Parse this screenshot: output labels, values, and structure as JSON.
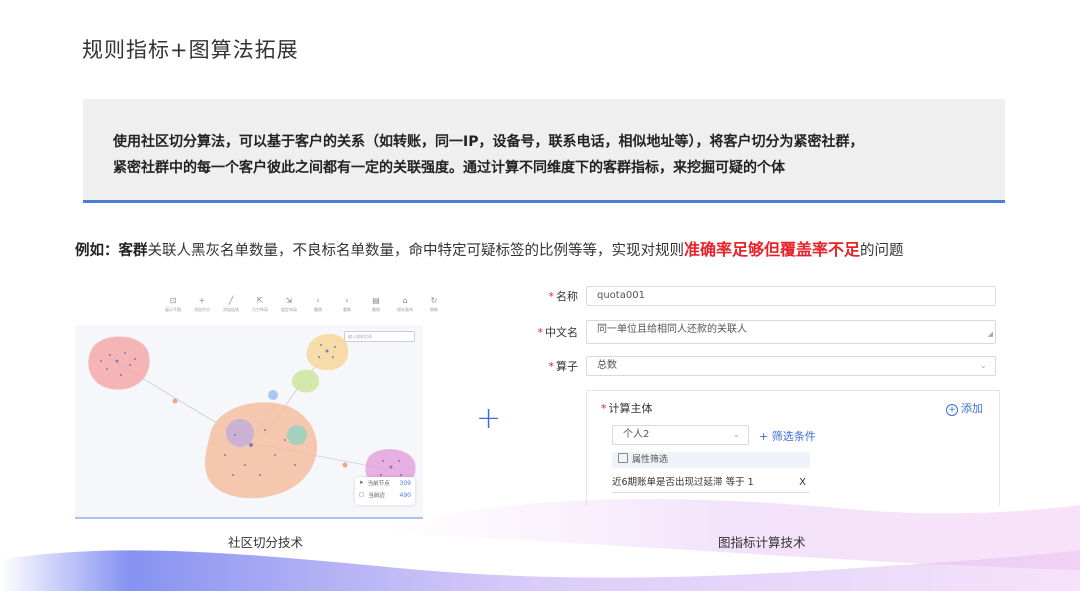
{
  "title": "规则指标+图算法拓展",
  "callout": {
    "line1": "使用社区切分算法，可以基于客户的关系（如转账，同一IP，设备号，联系电话，相似地址等），将客户切分为紧密社群，",
    "line2": "紧密社群中的每一个客户彼此之间都有一定的关联强度。通过计算不同维度下的客群指标，来挖掘可疑的个体"
  },
  "example": {
    "prefix": "例如：",
    "subject": "客群",
    "body": "关联人黑灰名单数量，不良标名单数量，命中特定可疑标签的比例等等，实现对规则",
    "highlight": "准确率足够但覆盖率不足",
    "suffix": "的问题"
  },
  "left_panel": {
    "toolbar": [
      {
        "icon": "subgraph-icon",
        "glyph": "⊡",
        "label": "展示子图"
      },
      {
        "icon": "add-node-icon",
        "glyph": "+",
        "label": "添加节点"
      },
      {
        "icon": "add-edge-icon",
        "glyph": "╱",
        "label": "添加连线"
      },
      {
        "icon": "force-layout-icon",
        "glyph": "⇱",
        "label": "引力布局"
      },
      {
        "icon": "fixed-layout-icon",
        "glyph": "⇲",
        "label": "固定布局"
      },
      {
        "icon": "undo-icon",
        "glyph": "‹",
        "label": "撤销"
      },
      {
        "icon": "redo-icon",
        "glyph": "›",
        "label": "重做"
      },
      {
        "icon": "delete-icon",
        "glyph": "▤",
        "label": "删除"
      },
      {
        "icon": "save-icon",
        "glyph": "⌂",
        "label": "保存画布"
      },
      {
        "icon": "refresh-icon",
        "glyph": "↻",
        "label": "刷新"
      }
    ],
    "search_placeholder": "输入搜索信息",
    "legend": {
      "nodes_label": "当前节点",
      "nodes_value": "309",
      "edges_label": "当前边",
      "edges_value": "490"
    },
    "caption": "社区切分技术"
  },
  "plus": "+",
  "form": {
    "name_label": "名称",
    "name_value": "quota001",
    "cn_name_label": "中文名",
    "cn_name_value": "同一单位且给相同人还款的关联人",
    "operator_label": "算子",
    "operator_value": "总数",
    "subject_label": "计算主体",
    "add_label": "添加",
    "subject_value": "个人2",
    "filter_link": "+ 筛选条件",
    "attr_filter": "属性筛选",
    "condition": "近6期账单是否出现过延滞   等于   1",
    "remove": "X",
    "caption": "图指标计算技术"
  },
  "colors": {
    "accent": "#3b6fd1",
    "highlight": "#e8222a",
    "divider": "#4a7fd4"
  }
}
